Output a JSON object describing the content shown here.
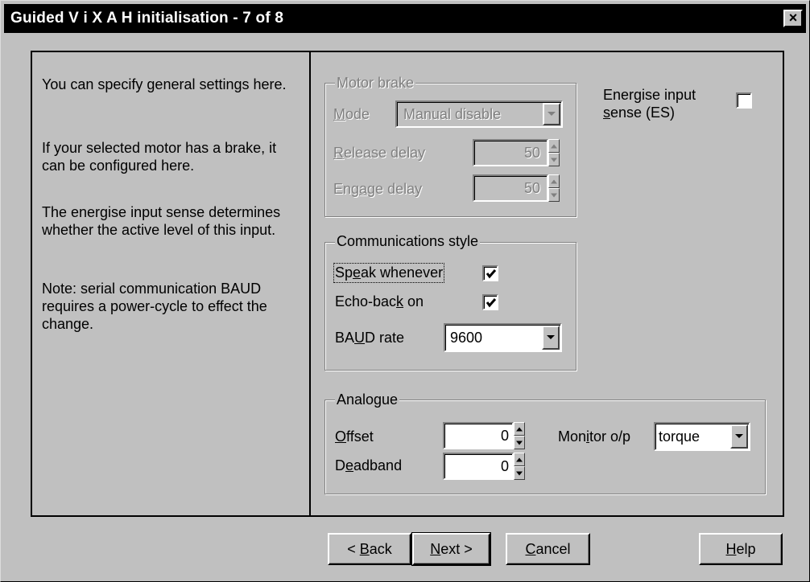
{
  "window": {
    "title": "Guided V i X A H initialisation - 7 of 8",
    "close_symbol": "×"
  },
  "info": {
    "paragraphs": [
      "You can specify general settings here.",
      "If your selected motor has a brake, it can be configured here.",
      "The energise input sense determines whether the active level of this input.",
      "Note: serial communication BAUD requires a power-cycle to effect the change."
    ]
  },
  "motor_brake": {
    "legend": "Motor brake",
    "mode_label": "Mode",
    "mode_value": "Manual disable",
    "release_label": "Release delay",
    "release_value": "50",
    "engage_label": "Engage delay",
    "engage_value": "50"
  },
  "energise": {
    "label_line1": "Energise input",
    "label_line2": "sense (ES)",
    "checked": false
  },
  "comms": {
    "legend": "Communications style",
    "speak_label": "Speak whenever",
    "speak_checked": true,
    "echo_label": "Echo-back on",
    "echo_checked": true,
    "baud_label": "BAUD rate",
    "baud_value": "9600"
  },
  "analogue": {
    "legend": "Analogue",
    "offset_label": "Offset",
    "offset_value": "0",
    "deadband_label": "Deadband",
    "deadband_value": "0",
    "monitor_label": "Monitor o/p",
    "monitor_value": "torque"
  },
  "buttons": {
    "back": "< Back",
    "next": "Next >",
    "cancel": "Cancel",
    "help": "Help"
  },
  "icons": {
    "close": "close-icon",
    "dropdown": "chevron-down-icon",
    "spin_up": "arrow-up-icon",
    "spin_down": "arrow-down-icon",
    "check": "checkmark-icon"
  },
  "colors": {
    "titlebar": "#000000",
    "face": "#c0c0c0",
    "disabled_text": "#808080"
  }
}
